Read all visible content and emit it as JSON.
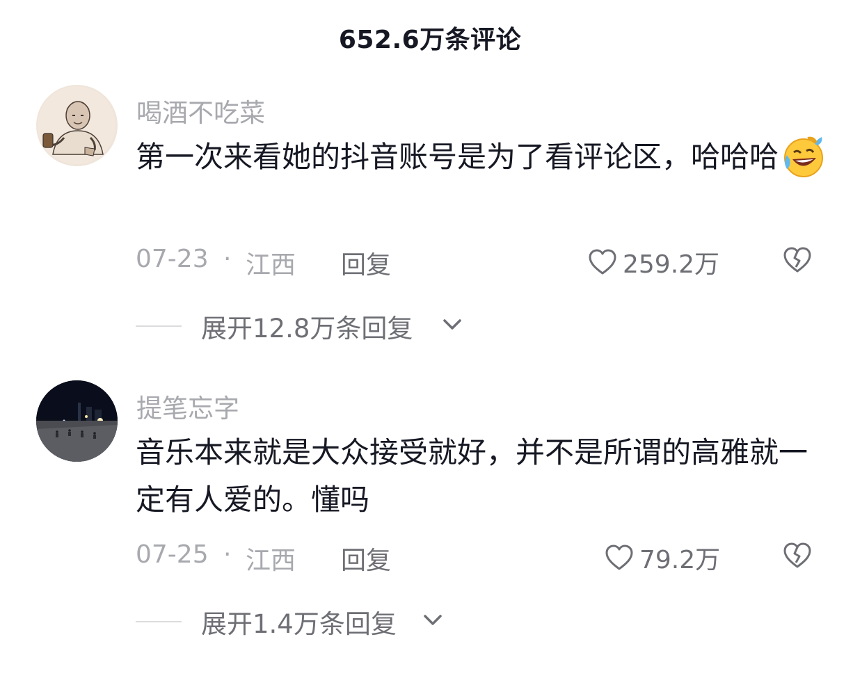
{
  "header": {
    "title": "652.6万条评论"
  },
  "comments": [
    {
      "username": "喝酒不吃菜",
      "text": "第一次来看她的抖音账号是为了看评论区，哈哈哈",
      "emoji_icon": "laughing-crying-emoji",
      "date": "07-23",
      "separator": "·",
      "location": "江西",
      "reply_label": "回复",
      "like_icon": "heart-outline-icon",
      "likes": "259.2万",
      "dislike_icon": "broken-heart-icon",
      "expand_label": "展开12.8万条回复",
      "expand_icon": "chevron-down-icon"
    },
    {
      "username": "提笔忘字",
      "text": "音乐本来就是大众接受就好，并不是所谓的高雅就一定有人爱的。懂吗",
      "date": "07-25",
      "separator": "·",
      "location": "江西",
      "reply_label": "回复",
      "like_icon": "heart-outline-icon",
      "likes": "79.2万",
      "dislike_icon": "broken-heart-icon",
      "expand_label": "展开1.4万条回复",
      "expand_icon": "chevron-down-icon"
    }
  ],
  "colors": {
    "primary_text": "#161823",
    "secondary_text": "#a8a9ae",
    "action_text": "#6e6f75",
    "divider": "#dcdcde",
    "background": "#ffffff"
  }
}
